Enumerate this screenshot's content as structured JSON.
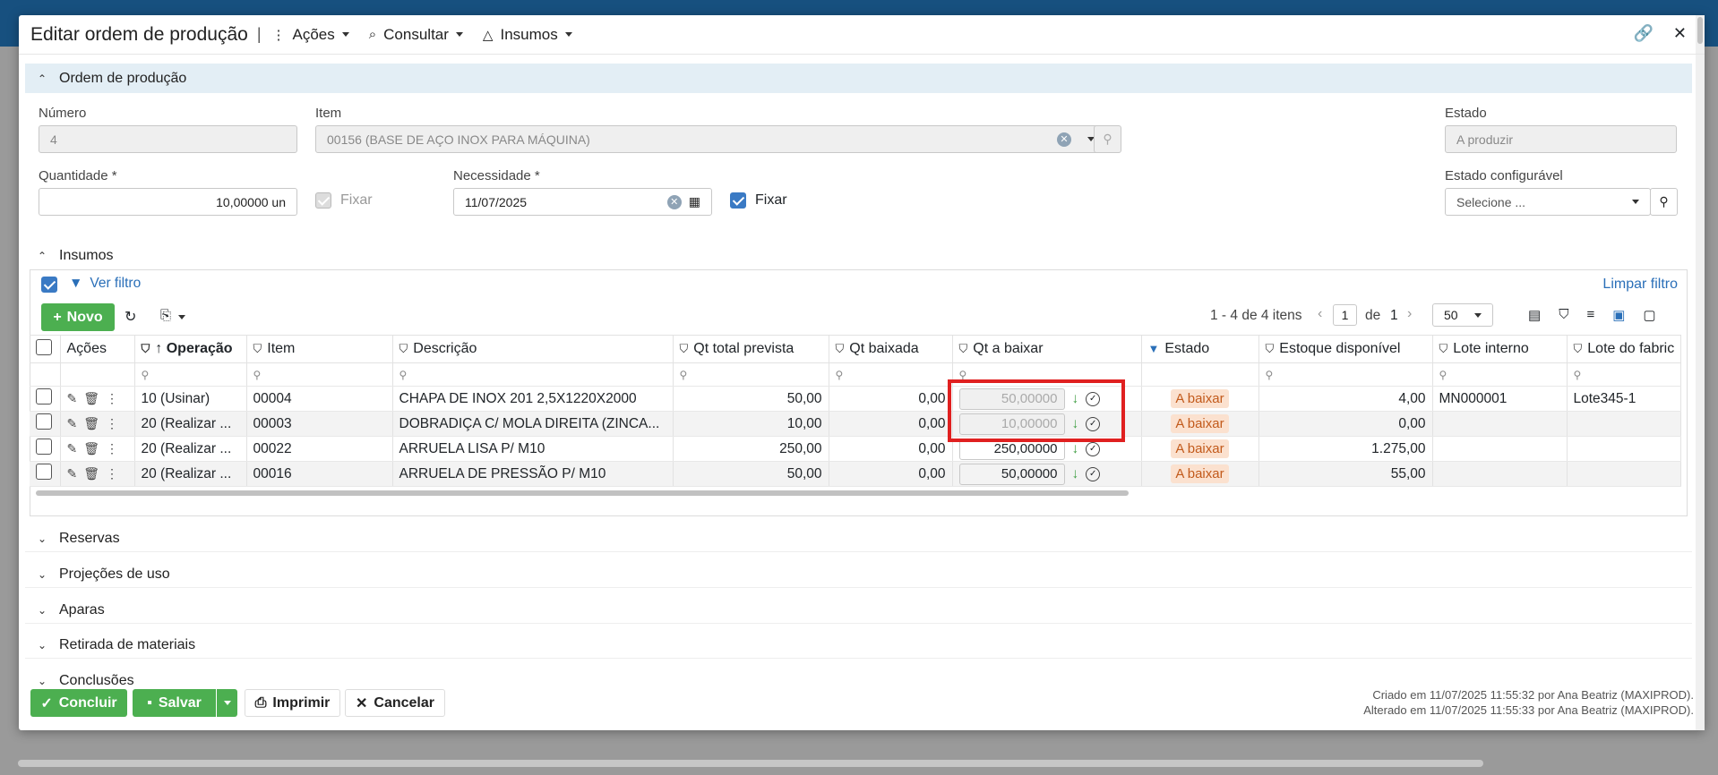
{
  "header": {
    "title": "Editar ordem de produção",
    "menus": [
      {
        "label": "Ações",
        "icon": "dots-vertical-icon"
      },
      {
        "label": "Consultar",
        "icon": "search-list-icon"
      },
      {
        "label": "Insumos",
        "icon": "shapes-icon"
      }
    ]
  },
  "ordem": {
    "section_title": "Ordem de produção",
    "numero_label": "Número",
    "numero_value": "4",
    "item_label": "Item",
    "item_value": "00156 (BASE DE AÇO INOX PARA MÁQUINA)",
    "estado_label": "Estado",
    "estado_value": "A produzir",
    "quantidade_label": "Quantidade *",
    "quantidade_value": "10,00000 un",
    "fixar1_label": "Fixar",
    "necessidade_label": "Necessidade *",
    "necessidade_value": "11/07/2025",
    "fixar2_label": "Fixar",
    "estado_config_label": "Estado configurável",
    "estado_config_placeholder": "Selecione ..."
  },
  "insumos": {
    "section_title": "Insumos",
    "ver_filtro": "Ver filtro",
    "limpar_filtro": "Limpar filtro",
    "novo_label": "Novo",
    "pager_info": "1 - 4 de 4 itens",
    "page_value": "1",
    "page_of": "de",
    "page_total": "1",
    "page_size": "50",
    "columns": [
      "Ações",
      "Operação",
      "Item",
      "Descrição",
      "Qt total prevista",
      "Qt baixada",
      "Qt a baixar",
      "Estado",
      "Estoque disponível",
      "Lote interno",
      "Lote do fabric"
    ],
    "rows": [
      {
        "operacao": "10 (Usinar)",
        "item": "00004",
        "descricao": "CHAPA DE INOX 201 2,5X1220X2000",
        "qt_total": "50,00",
        "qt_baixada": "0,00",
        "qt_a_baixar": "50,00000",
        "estado": "A baixar",
        "estoque": "4,00",
        "lote_interno": "MN000001",
        "lote_fabric": "Lote345-1"
      },
      {
        "operacao": "20 (Realizar ...",
        "item": "00003",
        "descricao": "DOBRADIÇA C/ MOLA DIREITA (ZINCA...",
        "qt_total": "10,00",
        "qt_baixada": "0,00",
        "qt_a_baixar": "10,00000",
        "estado": "A baixar",
        "estoque": "0,00",
        "lote_interno": "",
        "lote_fabric": ""
      },
      {
        "operacao": "20 (Realizar ...",
        "item": "00022",
        "descricao": "ARRUELA LISA P/ M10",
        "qt_total": "250,00",
        "qt_baixada": "0,00",
        "qt_a_baixar": "250,00000",
        "estado": "A baixar",
        "estoque": "1.275,00",
        "lote_interno": "",
        "lote_fabric": ""
      },
      {
        "operacao": "20 (Realizar ...",
        "item": "00016",
        "descricao": "ARRUELA DE PRESSÃO P/ M10",
        "qt_total": "50,00",
        "qt_baixada": "0,00",
        "qt_a_baixar": "50,00000",
        "estado": "A baixar",
        "estoque": "55,00",
        "lote_interno": "",
        "lote_fabric": ""
      }
    ]
  },
  "sections": [
    "Reservas",
    "Projeções de uso",
    "Aparas",
    "Retirada de materiais",
    "Conclusões"
  ],
  "footer": {
    "concluir": "Concluir",
    "salvar": "Salvar",
    "imprimir": "Imprimir",
    "cancelar": "Cancelar",
    "criado": "Criado em 11/07/2025 11:55:32 por Ana Beatriz (MAXIPROD).",
    "alterado": "Alterado em 11/07/2025 11:55:33 por Ana Beatriz (MAXIPROD)."
  }
}
